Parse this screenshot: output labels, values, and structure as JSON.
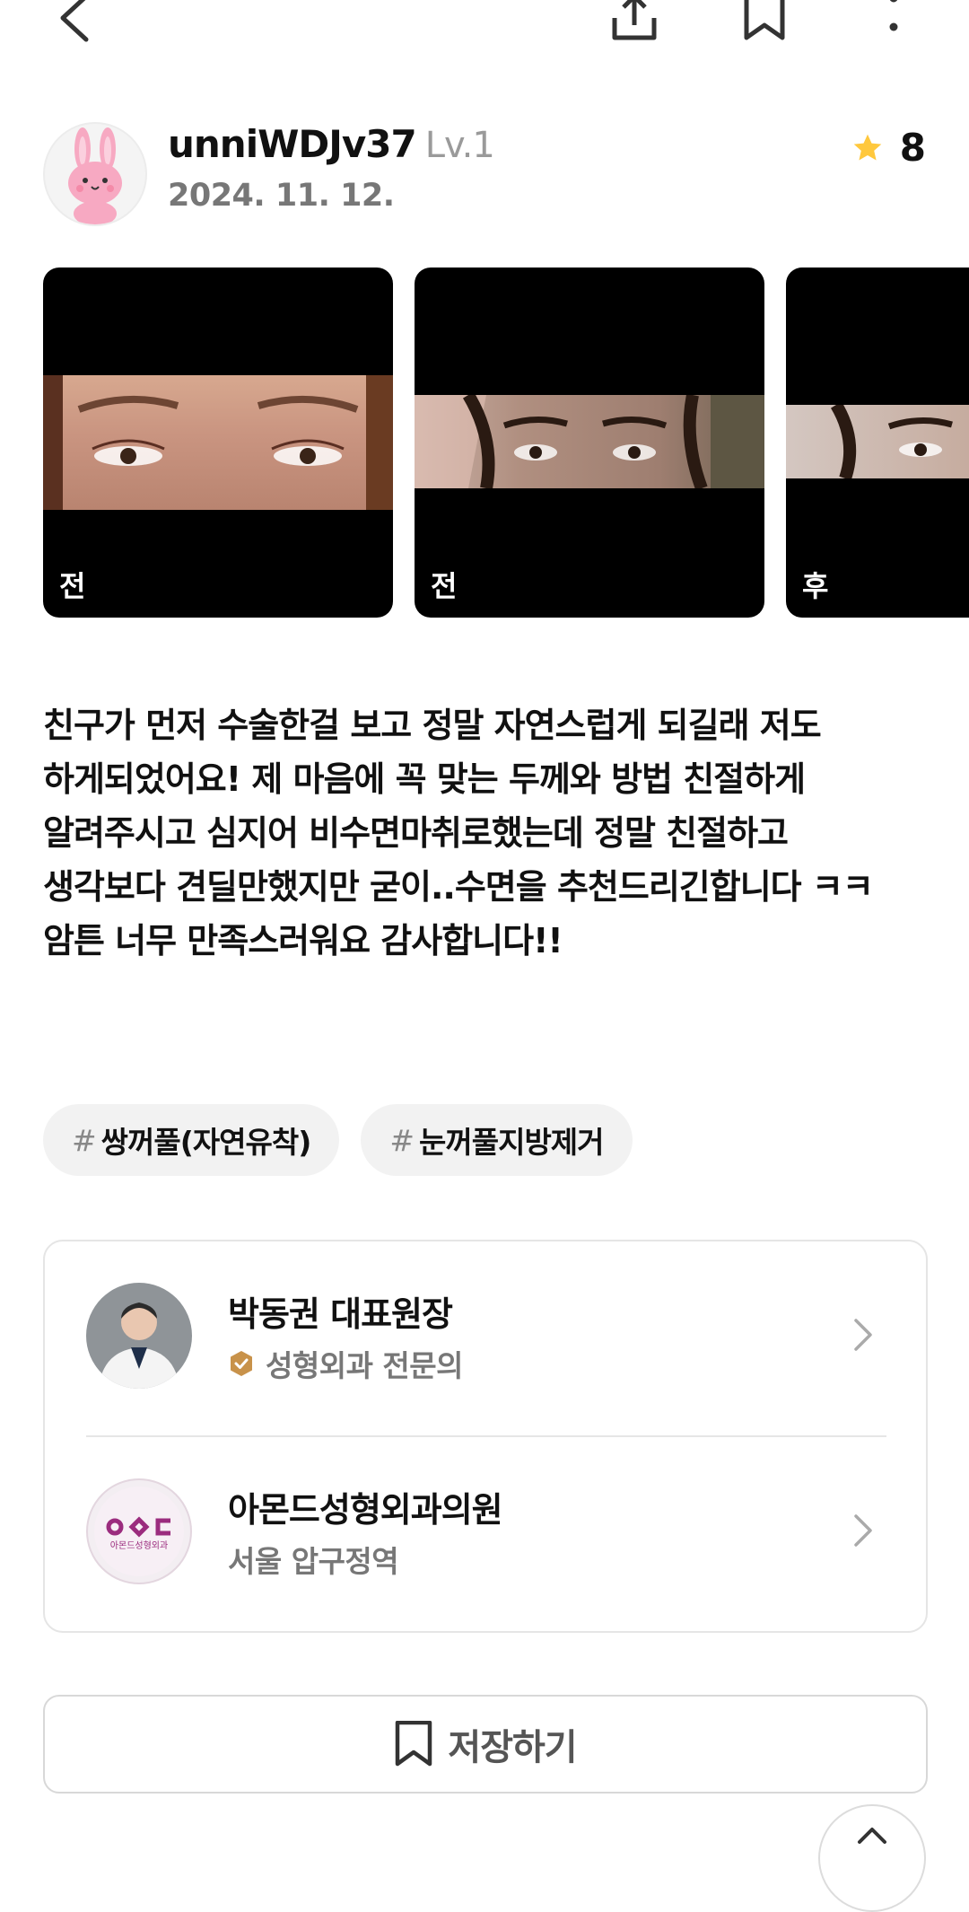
{
  "topbar": {
    "icons": [
      "chevron-left-icon",
      "share-icon",
      "bookmark-icon",
      "more-vertical-icon"
    ]
  },
  "author": {
    "username": "unniWDJv37",
    "level": "Lv.1",
    "date": "2024. 11. 12.",
    "rating": "8",
    "avatar_icon": "rabbit-avatar-icon"
  },
  "photos": [
    {
      "label": "전"
    },
    {
      "label": "전"
    },
    {
      "label": "후"
    }
  ],
  "review": {
    "text": "친구가 먼저 수술한걸 보고 정말 자연스럽게 되길래 저도\n하게되었어요! 제 마음에 꼭 맞는 두께와 방법 친절하게\n알려주시고 심지어 비수면마취로했는데 정말 친절하고\n생각보다 견딜만했지만 굳이..수면을 추천드리긴합니다 ㅋㅋ\n암튼 너무 만족스러워요 감사합니다!!"
  },
  "hashtags": [
    {
      "hash": "#",
      "label": "쌍꺼풀(자연유착)"
    },
    {
      "hash": "#",
      "label": "눈꺼풀지방제거"
    }
  ],
  "doctor": {
    "name": "박동권 대표원장",
    "specialty": "성형외과 전문의"
  },
  "clinic": {
    "name": "아몬드성형외과의원",
    "location": "서울 압구정역",
    "logo_text": "아몬드성형외과"
  },
  "save_button": {
    "label": "저장하기"
  },
  "colors": {
    "star": "#FFC83D",
    "badge": "#C8924A",
    "clinic_logo": "#9B2C7E"
  }
}
